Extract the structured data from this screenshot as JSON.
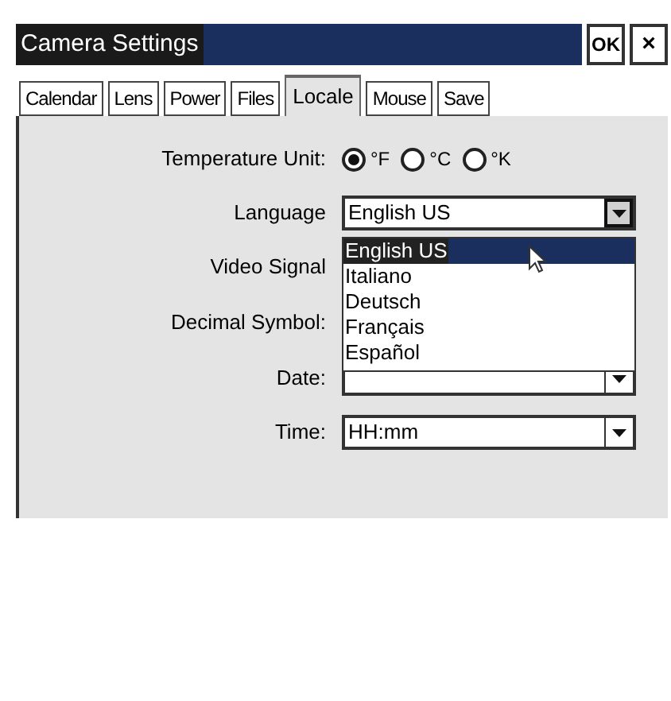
{
  "window": {
    "title": "Camera Settings",
    "buttons": [
      "OK",
      "×"
    ]
  },
  "tabs": [
    {
      "label": "Calendar",
      "selected": false
    },
    {
      "label": "Lens",
      "selected": false
    },
    {
      "label": "Power",
      "selected": false
    },
    {
      "label": "Files",
      "selected": false
    },
    {
      "label": "Locale",
      "selected": true
    },
    {
      "label": "Mouse",
      "selected": false
    },
    {
      "label": "Save",
      "selected": false
    }
  ],
  "temperature": {
    "label": "Temperature Unit:",
    "options": [
      {
        "label": "°F",
        "selected": true
      },
      {
        "label": "°C",
        "selected": false
      },
      {
        "label": "°K",
        "selected": false
      }
    ]
  },
  "language": {
    "label": "Language",
    "value": "English US",
    "expanded": true,
    "options": [
      {
        "label": "English US",
        "selected": true
      },
      {
        "label": "Italiano",
        "selected": false
      },
      {
        "label": "Deutsch",
        "selected": false
      },
      {
        "label": "Français",
        "selected": false
      },
      {
        "label": "Español",
        "selected": false
      }
    ]
  },
  "video_signal": {
    "label": "Video Signal"
  },
  "decimal_symbol": {
    "label": "Decimal Symbol:"
  },
  "date": {
    "label": "Date:"
  },
  "time": {
    "label": "Time:",
    "value": "HH:mm"
  }
}
